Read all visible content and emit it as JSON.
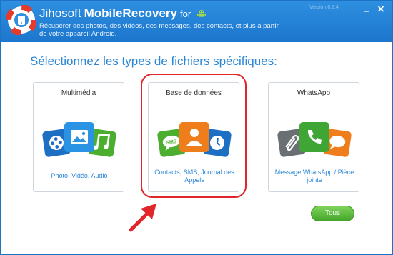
{
  "header": {
    "brand": "Jihosoft",
    "product": "MobileRecovery",
    "for_label": "for",
    "platform_icon": "android-icon",
    "subtitle": "Récupérer des photos, des vidéos, des messages, des contacts, et plus à partir de votre appareil Android.",
    "version": "Version 6.2.4",
    "accent_color": "#1c76cd"
  },
  "main": {
    "heading": "Sélectionnez les types de fichiers spécifiques:",
    "cards": [
      {
        "title": "Multimédia",
        "caption": "Photo, Vidéo, Audio",
        "icons": [
          "film-icon",
          "image-icon",
          "music-note-icon"
        ]
      },
      {
        "title": "Base de données",
        "caption": "Contacts, SMS, Journal des Appels",
        "icons": [
          "sms-icon",
          "contact-icon",
          "clock-icon"
        ],
        "highlighted": true
      },
      {
        "title": "WhatsApp",
        "caption": "Message WhatsApp / Pièce jointe",
        "icons": [
          "paperclip-icon",
          "phone-icon",
          "chat-bubble-icon"
        ]
      }
    ],
    "all_button_label": "Tous",
    "highlight_color": "#e0262b"
  }
}
